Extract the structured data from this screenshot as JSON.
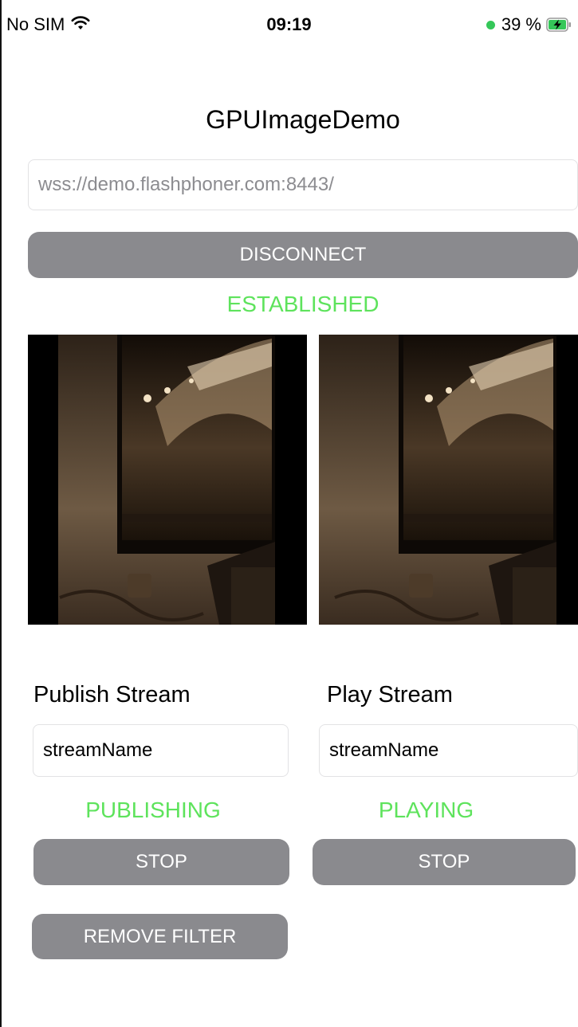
{
  "status_bar": {
    "carrier": "No SIM",
    "time": "09:19",
    "battery_percent": "39 %",
    "wifi_icon": "wifi-icon",
    "battery_icon": "battery-charging-icon",
    "dot_color": "#35c759"
  },
  "app": {
    "title": "GPUImageDemo"
  },
  "connection": {
    "url_value": "wss://demo.flashphoner.com:8443/",
    "disconnect_label": "DISCONNECT",
    "status": "ESTABLISHED"
  },
  "publish": {
    "label": "Publish Stream",
    "stream_name": "streamName",
    "status": "PUBLISHING",
    "stop_label": "STOP",
    "remove_filter_label": "REMOVE FILTER"
  },
  "play": {
    "label": "Play Stream",
    "stream_name": "streamName",
    "status": "PLAYING",
    "stop_label": "STOP"
  },
  "colors": {
    "button_bg": "#8a8a8e",
    "status_green": "#5ee35c",
    "sepia_dark": "#1a120a",
    "sepia_light": "#b89a76"
  }
}
